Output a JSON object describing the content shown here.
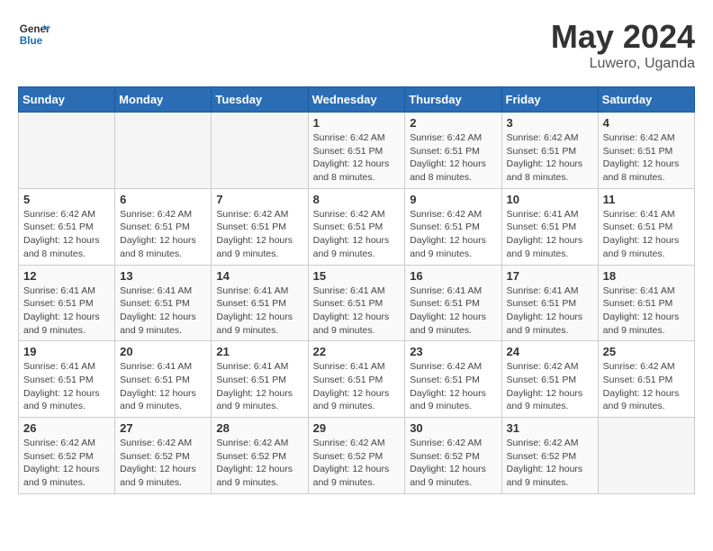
{
  "header": {
    "logo_text_general": "General",
    "logo_text_blue": "Blue",
    "month": "May 2024",
    "location": "Luwero, Uganda"
  },
  "days_of_week": [
    "Sunday",
    "Monday",
    "Tuesday",
    "Wednesday",
    "Thursday",
    "Friday",
    "Saturday"
  ],
  "weeks": [
    [
      {
        "day": "",
        "sunrise": "",
        "sunset": "",
        "daylight": "",
        "empty": true
      },
      {
        "day": "",
        "sunrise": "",
        "sunset": "",
        "daylight": "",
        "empty": true
      },
      {
        "day": "",
        "sunrise": "",
        "sunset": "",
        "daylight": "",
        "empty": true
      },
      {
        "day": "1",
        "sunrise": "Sunrise: 6:42 AM",
        "sunset": "Sunset: 6:51 PM",
        "daylight": "Daylight: 12 hours and 8 minutes."
      },
      {
        "day": "2",
        "sunrise": "Sunrise: 6:42 AM",
        "sunset": "Sunset: 6:51 PM",
        "daylight": "Daylight: 12 hours and 8 minutes."
      },
      {
        "day": "3",
        "sunrise": "Sunrise: 6:42 AM",
        "sunset": "Sunset: 6:51 PM",
        "daylight": "Daylight: 12 hours and 8 minutes."
      },
      {
        "day": "4",
        "sunrise": "Sunrise: 6:42 AM",
        "sunset": "Sunset: 6:51 PM",
        "daylight": "Daylight: 12 hours and 8 minutes."
      }
    ],
    [
      {
        "day": "5",
        "sunrise": "Sunrise: 6:42 AM",
        "sunset": "Sunset: 6:51 PM",
        "daylight": "Daylight: 12 hours and 8 minutes."
      },
      {
        "day": "6",
        "sunrise": "Sunrise: 6:42 AM",
        "sunset": "Sunset: 6:51 PM",
        "daylight": "Daylight: 12 hours and 8 minutes."
      },
      {
        "day": "7",
        "sunrise": "Sunrise: 6:42 AM",
        "sunset": "Sunset: 6:51 PM",
        "daylight": "Daylight: 12 hours and 9 minutes."
      },
      {
        "day": "8",
        "sunrise": "Sunrise: 6:42 AM",
        "sunset": "Sunset: 6:51 PM",
        "daylight": "Daylight: 12 hours and 9 minutes."
      },
      {
        "day": "9",
        "sunrise": "Sunrise: 6:42 AM",
        "sunset": "Sunset: 6:51 PM",
        "daylight": "Daylight: 12 hours and 9 minutes."
      },
      {
        "day": "10",
        "sunrise": "Sunrise: 6:41 AM",
        "sunset": "Sunset: 6:51 PM",
        "daylight": "Daylight: 12 hours and 9 minutes."
      },
      {
        "day": "11",
        "sunrise": "Sunrise: 6:41 AM",
        "sunset": "Sunset: 6:51 PM",
        "daylight": "Daylight: 12 hours and 9 minutes."
      }
    ],
    [
      {
        "day": "12",
        "sunrise": "Sunrise: 6:41 AM",
        "sunset": "Sunset: 6:51 PM",
        "daylight": "Daylight: 12 hours and 9 minutes."
      },
      {
        "day": "13",
        "sunrise": "Sunrise: 6:41 AM",
        "sunset": "Sunset: 6:51 PM",
        "daylight": "Daylight: 12 hours and 9 minutes."
      },
      {
        "day": "14",
        "sunrise": "Sunrise: 6:41 AM",
        "sunset": "Sunset: 6:51 PM",
        "daylight": "Daylight: 12 hours and 9 minutes."
      },
      {
        "day": "15",
        "sunrise": "Sunrise: 6:41 AM",
        "sunset": "Sunset: 6:51 PM",
        "daylight": "Daylight: 12 hours and 9 minutes."
      },
      {
        "day": "16",
        "sunrise": "Sunrise: 6:41 AM",
        "sunset": "Sunset: 6:51 PM",
        "daylight": "Daylight: 12 hours and 9 minutes."
      },
      {
        "day": "17",
        "sunrise": "Sunrise: 6:41 AM",
        "sunset": "Sunset: 6:51 PM",
        "daylight": "Daylight: 12 hours and 9 minutes."
      },
      {
        "day": "18",
        "sunrise": "Sunrise: 6:41 AM",
        "sunset": "Sunset: 6:51 PM",
        "daylight": "Daylight: 12 hours and 9 minutes."
      }
    ],
    [
      {
        "day": "19",
        "sunrise": "Sunrise: 6:41 AM",
        "sunset": "Sunset: 6:51 PM",
        "daylight": "Daylight: 12 hours and 9 minutes."
      },
      {
        "day": "20",
        "sunrise": "Sunrise: 6:41 AM",
        "sunset": "Sunset: 6:51 PM",
        "daylight": "Daylight: 12 hours and 9 minutes."
      },
      {
        "day": "21",
        "sunrise": "Sunrise: 6:41 AM",
        "sunset": "Sunset: 6:51 PM",
        "daylight": "Daylight: 12 hours and 9 minutes."
      },
      {
        "day": "22",
        "sunrise": "Sunrise: 6:41 AM",
        "sunset": "Sunset: 6:51 PM",
        "daylight": "Daylight: 12 hours and 9 minutes."
      },
      {
        "day": "23",
        "sunrise": "Sunrise: 6:42 AM",
        "sunset": "Sunset: 6:51 PM",
        "daylight": "Daylight: 12 hours and 9 minutes."
      },
      {
        "day": "24",
        "sunrise": "Sunrise: 6:42 AM",
        "sunset": "Sunset: 6:51 PM",
        "daylight": "Daylight: 12 hours and 9 minutes."
      },
      {
        "day": "25",
        "sunrise": "Sunrise: 6:42 AM",
        "sunset": "Sunset: 6:51 PM",
        "daylight": "Daylight: 12 hours and 9 minutes."
      }
    ],
    [
      {
        "day": "26",
        "sunrise": "Sunrise: 6:42 AM",
        "sunset": "Sunset: 6:52 PM",
        "daylight": "Daylight: 12 hours and 9 minutes."
      },
      {
        "day": "27",
        "sunrise": "Sunrise: 6:42 AM",
        "sunset": "Sunset: 6:52 PM",
        "daylight": "Daylight: 12 hours and 9 minutes."
      },
      {
        "day": "28",
        "sunrise": "Sunrise: 6:42 AM",
        "sunset": "Sunset: 6:52 PM",
        "daylight": "Daylight: 12 hours and 9 minutes."
      },
      {
        "day": "29",
        "sunrise": "Sunrise: 6:42 AM",
        "sunset": "Sunset: 6:52 PM",
        "daylight": "Daylight: 12 hours and 9 minutes."
      },
      {
        "day": "30",
        "sunrise": "Sunrise: 6:42 AM",
        "sunset": "Sunset: 6:52 PM",
        "daylight": "Daylight: 12 hours and 9 minutes."
      },
      {
        "day": "31",
        "sunrise": "Sunrise: 6:42 AM",
        "sunset": "Sunset: 6:52 PM",
        "daylight": "Daylight: 12 hours and 9 minutes."
      },
      {
        "day": "",
        "sunrise": "",
        "sunset": "",
        "daylight": "",
        "empty": true
      }
    ]
  ]
}
